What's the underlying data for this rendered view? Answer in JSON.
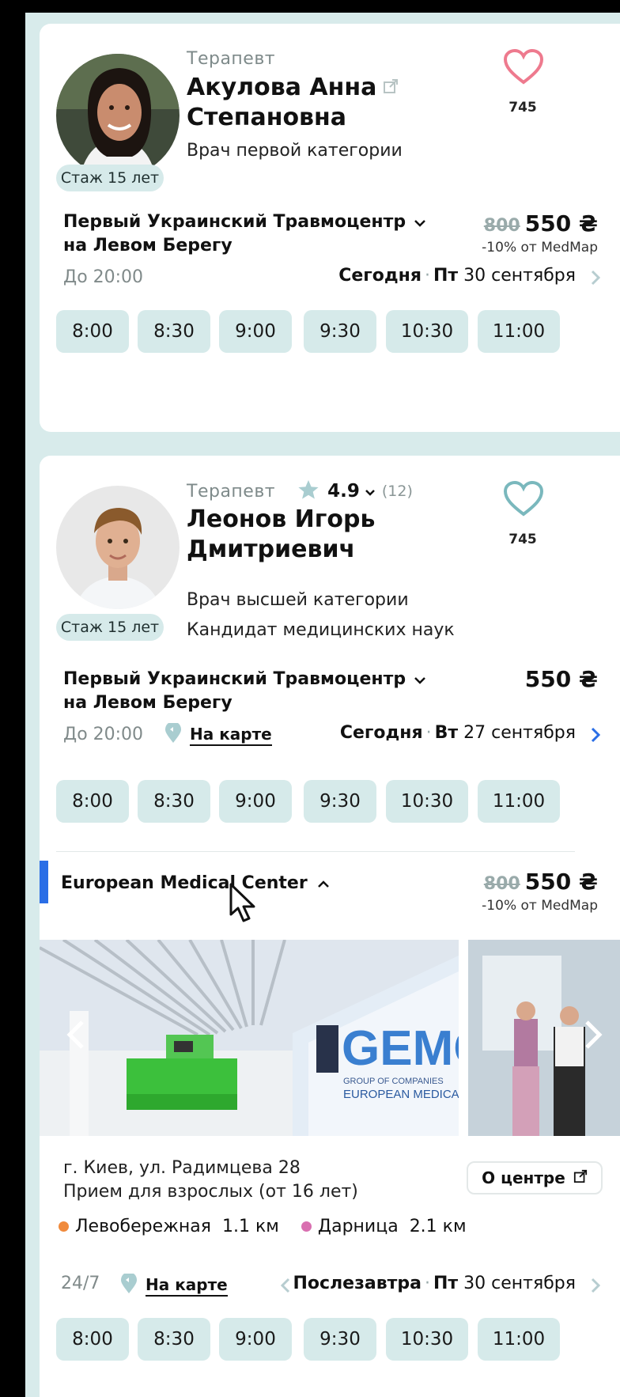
{
  "doctors": [
    {
      "specialty": "Терапевт",
      "name_line1": "Акулова Анна",
      "name_line2": "Степановна",
      "category": "Врач первой категории",
      "experience": "Стаж 15 лет",
      "likes": "745",
      "clinic_line1": "Первый Украинский Травмоцентр",
      "clinic_line2": "на Левом Берегу",
      "old_price": "800",
      "price": "550 ₴",
      "discount": "-10% от MedMap",
      "hours": "До 20:00",
      "day_label": "Сегодня",
      "dot": "·",
      "weekday": "Пт",
      "date": "30 сентября",
      "slots": [
        "8:00",
        "8:30",
        "9:00",
        "9:30",
        "10:30",
        "11:00"
      ]
    },
    {
      "specialty": "Терапевт",
      "rating": "4.9",
      "reviews": "(12)",
      "name_line1": "Леонов Игорь",
      "name_line2": "Дмитриевич",
      "category": "Врач высшей категории",
      "degree": "Кандидат медицинских наук",
      "experience": "Стаж 15 лет",
      "likes": "745",
      "clinic_line1": "Первый Украинский Травмоцентр",
      "clinic_line2": "на Левом Берегу",
      "price": "550 ₴",
      "hours": "До 20:00",
      "map_link": "На карте",
      "day_label": "Сегодня",
      "dot": "·",
      "weekday": "Вт",
      "date": "27 сентября",
      "slots": [
        "8:00",
        "8:30",
        "9:00",
        "9:30",
        "10:30",
        "11:00"
      ],
      "clinic2": {
        "name": "European Medical Center",
        "old_price": "800",
        "price": "550 ₴",
        "discount": "-10% от MedMap",
        "address_line1": "г. Киев, ул. Радимцева 28",
        "address_line2": "Прием для взрослых (от 16 лет)",
        "about_button": "О центре",
        "metro": [
          {
            "name": "Левобережная",
            "distance": "1.1 км",
            "color": "#f08a3c"
          },
          {
            "name": "Дарница",
            "distance": "2.1 км",
            "color": "#d96fb0"
          }
        ],
        "hours": "24/7",
        "map_link": "На карте",
        "day_label": "Послезавтра",
        "dot": "·",
        "weekday": "Пт",
        "date": "30 сентября",
        "slots": [
          "8:00",
          "8:30",
          "9:00",
          "9:30",
          "10:30",
          "11:00"
        ],
        "photo_sign_main": "GEMC",
        "photo_sign_sub1": "GROUP OF COMPANIES",
        "photo_sign_sub2": "EUROPEAN MEDICAL CENTER"
      }
    }
  ],
  "colors": {
    "frame": "#d8ebeb",
    "slot_bg": "#d6eaea",
    "heart_pink": "#ee7a8e",
    "heart_teal": "#7ab8bd",
    "chevron_active": "#2a6ee6",
    "accent_bar": "#2a6ee6"
  }
}
